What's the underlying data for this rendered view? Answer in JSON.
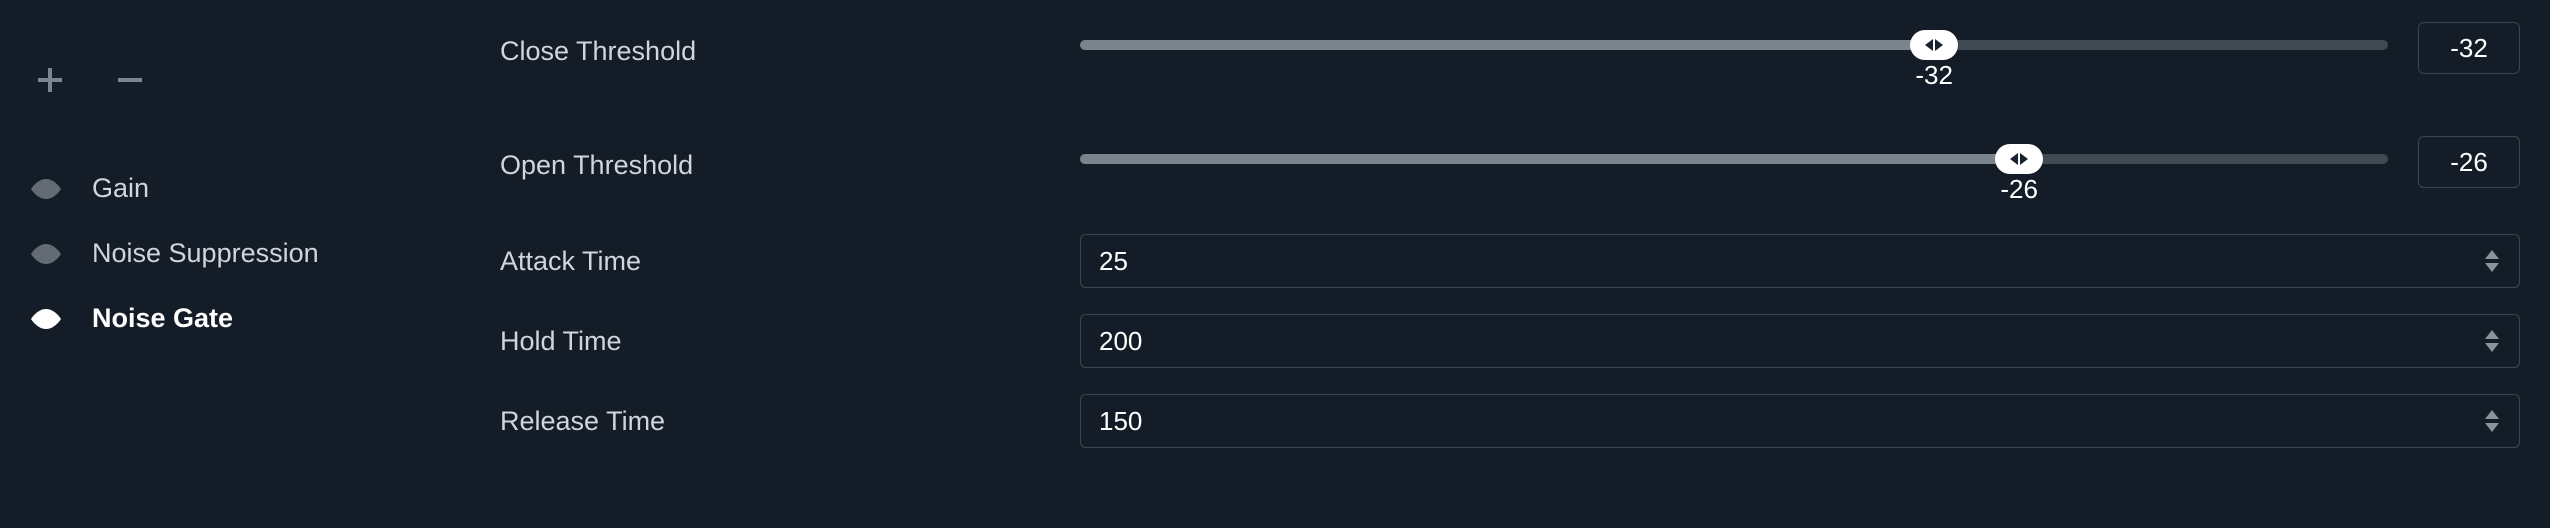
{
  "sidebar": {
    "items": [
      {
        "label": "Gain"
      },
      {
        "label": "Noise Suppression"
      },
      {
        "label": "Noise Gate"
      }
    ]
  },
  "params": {
    "close_threshold": {
      "label": "Close Threshold",
      "value": "-32",
      "value_text": "-32",
      "percent": 65.3
    },
    "open_threshold": {
      "label": "Open Threshold",
      "value": "-26",
      "value_text": "-26",
      "percent": 71.8
    },
    "attack_time": {
      "label": "Attack Time",
      "value": "25"
    },
    "hold_time": {
      "label": "Hold Time",
      "value": "200"
    },
    "release_time": {
      "label": "Release Time",
      "value": "150"
    }
  }
}
